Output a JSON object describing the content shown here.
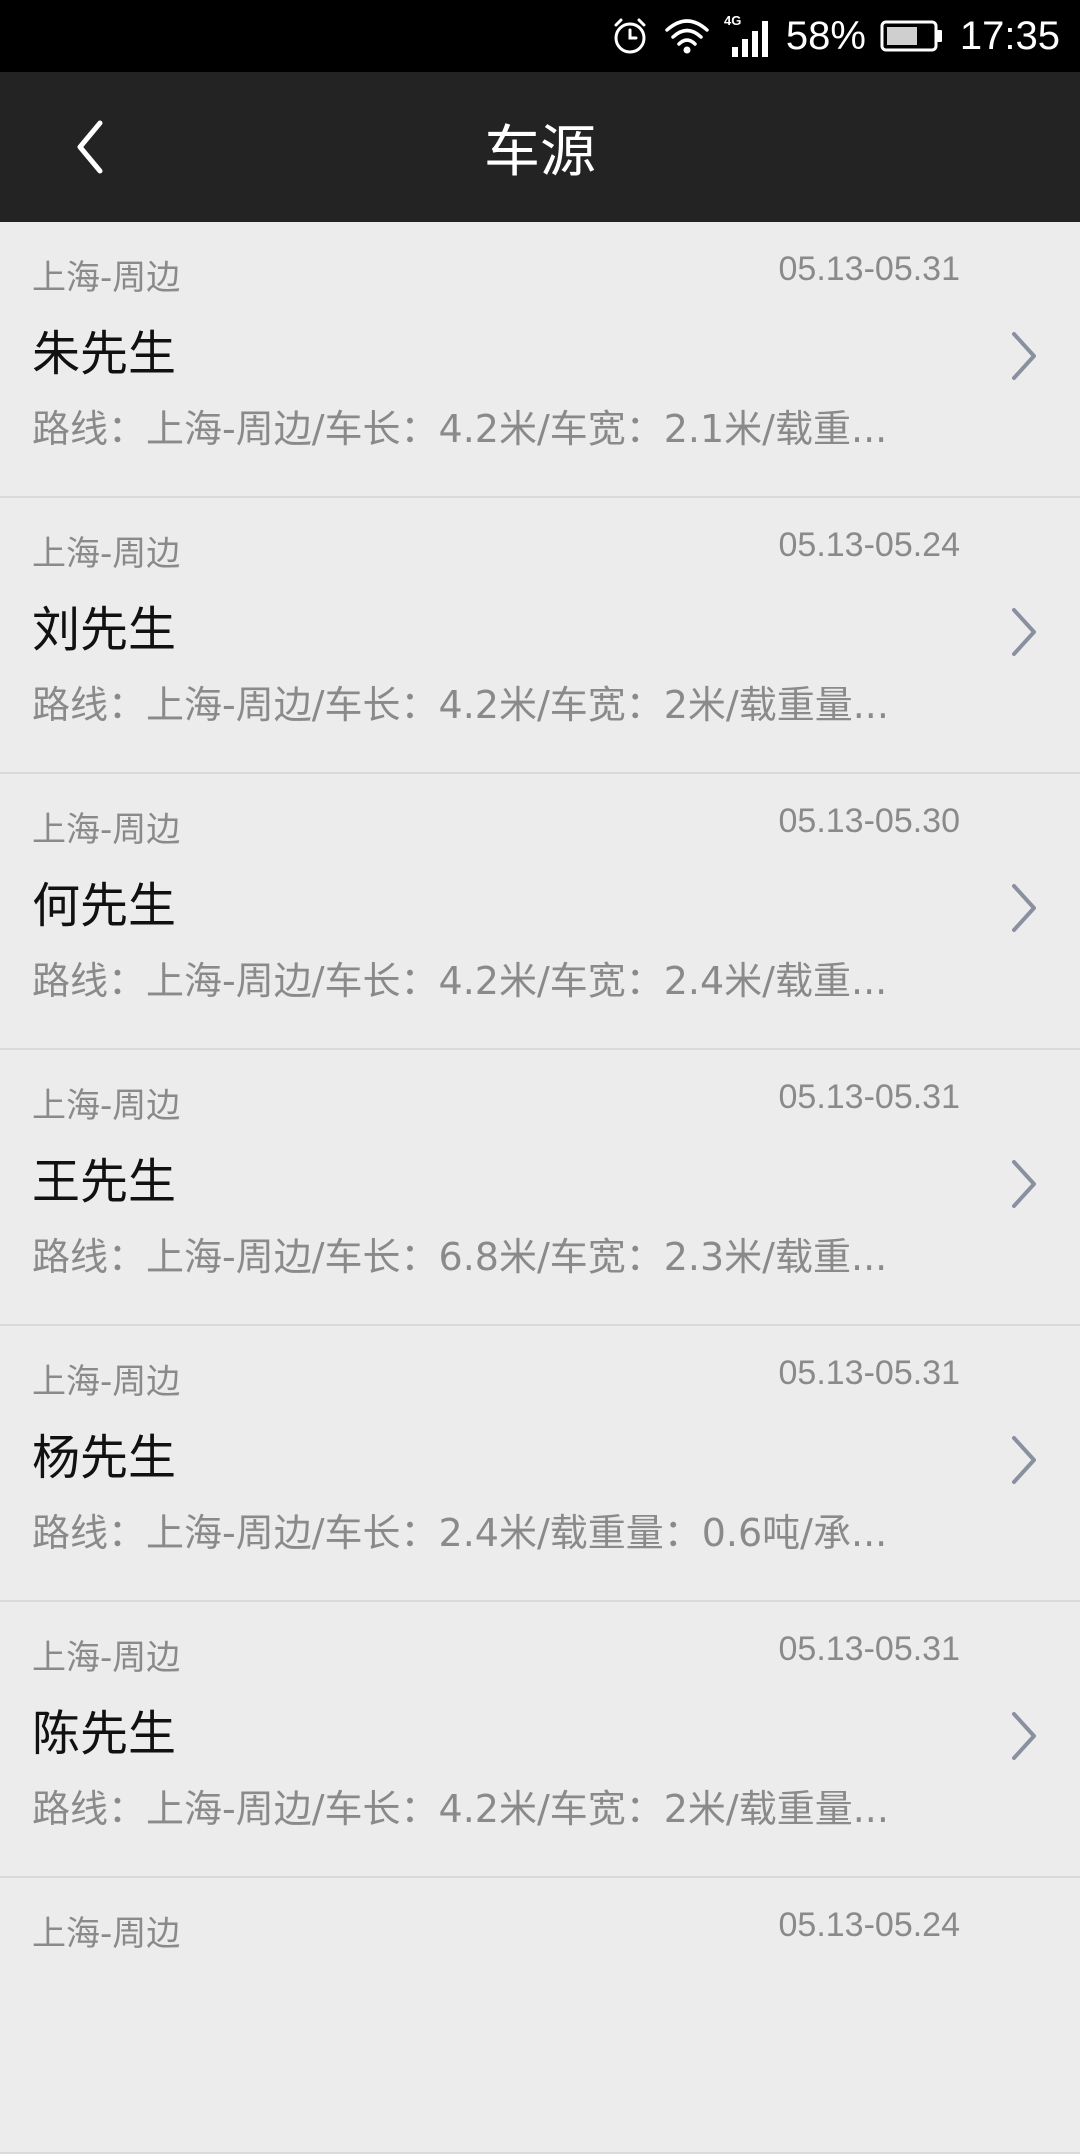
{
  "status_bar": {
    "icons": [
      "alarm-icon",
      "wifi-icon",
      "signal-4g-icon",
      "battery-icon"
    ],
    "network_label": "4G",
    "battery_percent": "58%",
    "time": "17:35"
  },
  "nav": {
    "title": "车源",
    "back_icon": "chevron-left-icon"
  },
  "list": {
    "items": [
      {
        "region": "上海-周边",
        "date": "05.13-05.31",
        "name": "朱先生",
        "detail": "路线：上海-周边/车长：4.2米/车宽：2.1米/载重..."
      },
      {
        "region": "上海-周边",
        "date": "05.13-05.24",
        "name": "刘先生",
        "detail": "路线：上海-周边/车长：4.2米/车宽：2米/载重量..."
      },
      {
        "region": "上海-周边",
        "date": "05.13-05.30",
        "name": "何先生",
        "detail": "路线：上海-周边/车长：4.2米/车宽：2.4米/载重..."
      },
      {
        "region": "上海-周边",
        "date": "05.13-05.31",
        "name": "王先生",
        "detail": "路线：上海-周边/车长：6.8米/车宽：2.3米/载重..."
      },
      {
        "region": "上海-周边",
        "date": "05.13-05.31",
        "name": "杨先生",
        "detail": "路线：上海-周边/车长：2.4米/载重量：0.6吨/承..."
      },
      {
        "region": "上海-周边",
        "date": "05.13-05.31",
        "name": "陈先生",
        "detail": "路线：上海-周边/车长：4.2米/车宽：2米/载重量..."
      },
      {
        "region": "上海-周边",
        "date": "05.13-05.24",
        "name": "",
        "detail": ""
      }
    ]
  },
  "colors": {
    "status_bar_bg": "#000000",
    "nav_bg": "#232323",
    "list_bg": "#ececec",
    "secondary_text": "#8a8a8a",
    "primary_text": "#111111"
  }
}
